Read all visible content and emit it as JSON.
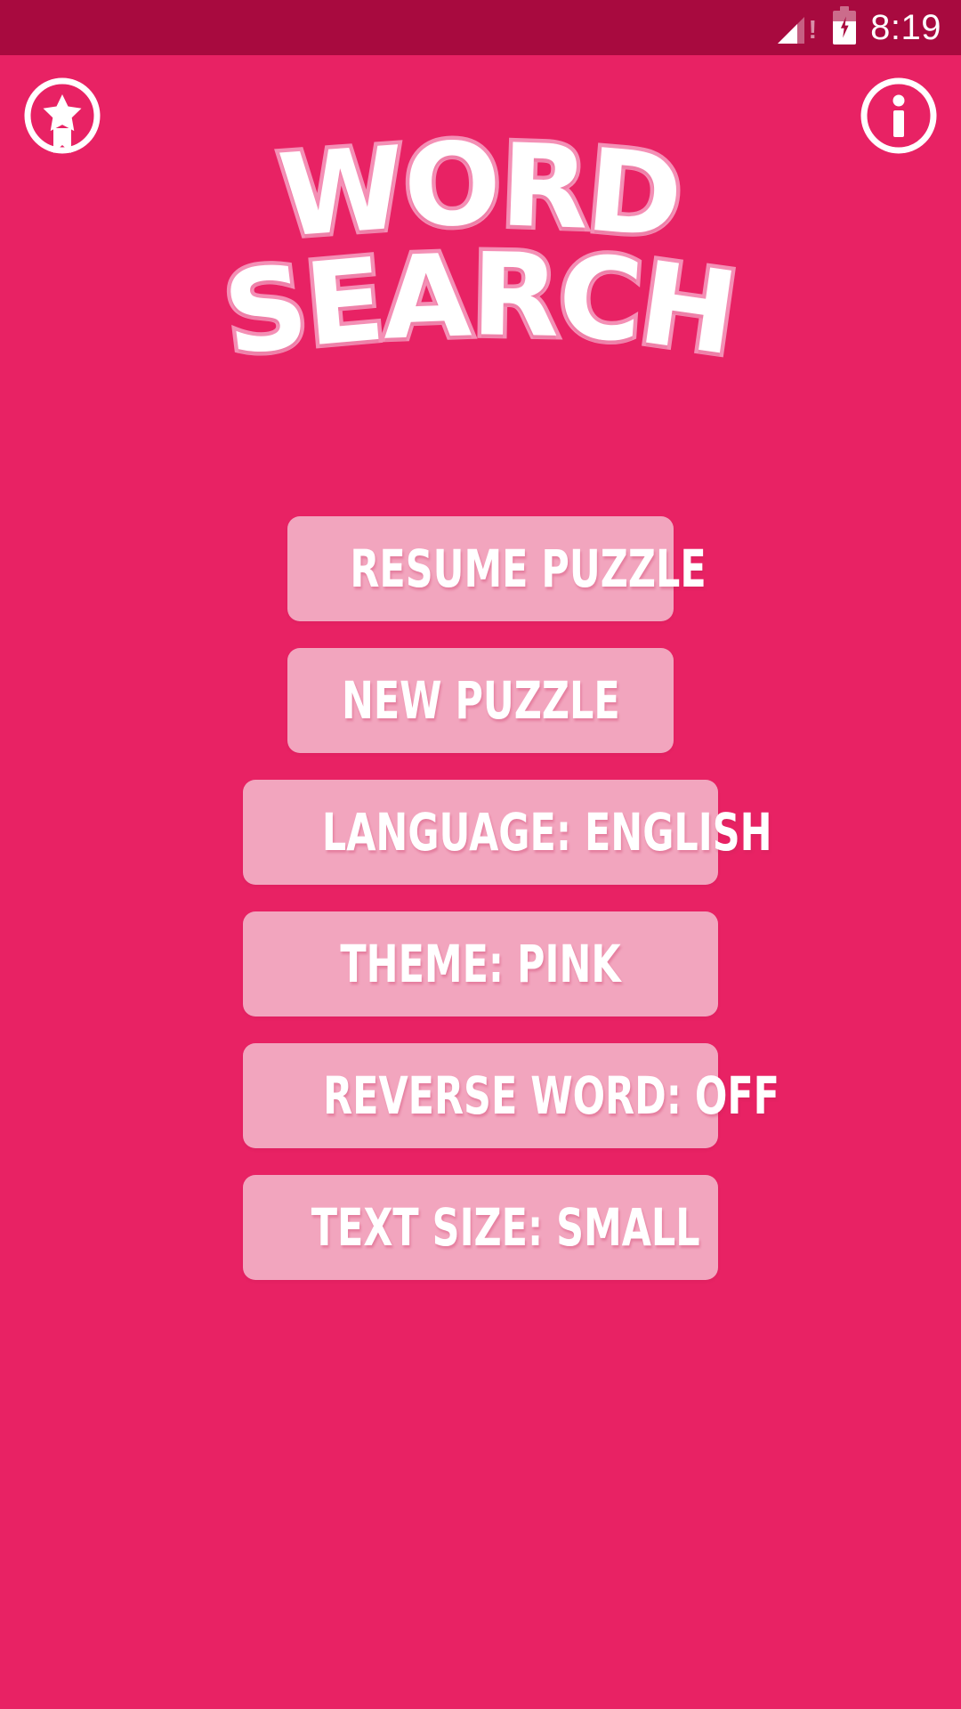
{
  "status_bar": {
    "time": "8:19",
    "signal_icon": "signal-warning-icon",
    "battery_icon": "battery-charging-icon",
    "background_color": "#A80A3F"
  },
  "theme": {
    "background_color": "#E82264",
    "button_color": "#F2A5BE",
    "logo_outline_color": "#F48FB5",
    "text_color": "#FFFFFF"
  },
  "header": {
    "badge_icon": "award-badge-icon",
    "info_icon": "info-icon",
    "logo_line_1": "WORD",
    "logo_line_2": "SEARCH"
  },
  "menu": {
    "buttons": [
      {
        "id": "resume-puzzle",
        "label": "RESUME PUZZLE",
        "width": "narrow"
      },
      {
        "id": "new-puzzle",
        "label": "NEW PUZZLE",
        "width": "narrow"
      },
      {
        "id": "language",
        "label": "LANGUAGE: ENGLISH",
        "width": "wide"
      },
      {
        "id": "theme",
        "label": "THEME: PINK",
        "width": "wide"
      },
      {
        "id": "reverse-word",
        "label": "REVERSE WORD: OFF",
        "width": "wide"
      },
      {
        "id": "text-size",
        "label": "TEXT SIZE: SMALL",
        "width": "wide"
      }
    ]
  },
  "settings_values": {
    "language": "ENGLISH",
    "theme": "PINK",
    "reverse_word": "OFF",
    "text_size": "SMALL"
  }
}
